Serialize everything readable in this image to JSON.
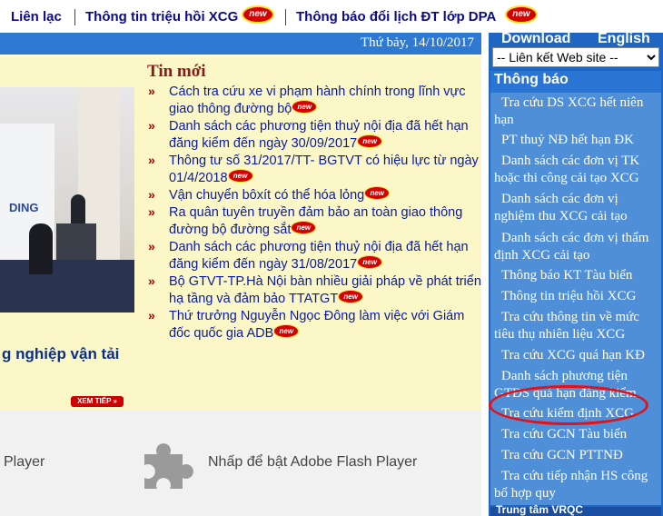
{
  "topnav": {
    "contact": "Liên lạc",
    "recall_info": "Thông tin triệu hồi XCG",
    "schedule_change": "Thông báo đổi lịch ĐT lớp DPA",
    "new_badge": "new"
  },
  "datebar": {
    "date": "Thứ bảy, 14/10/2017"
  },
  "banner": {
    "caption": "g nghiệp vận tải",
    "more_label": "XEM TIẾP »",
    "logo_fragment": "DING"
  },
  "news": {
    "heading": "Tin mới",
    "items": [
      "Cách tra cứu xe vi phạm hành chính trong lĩnh vực giao thông đường bộ",
      "Danh sách các phương tiện thuỷ nội địa đã hết hạn đăng kiểm đến ngày 30/09/2017",
      "Thông tư số 31/2017/TT- BGTVT có hiệu lực từ ngày 01/4/2018",
      "Vận chuyển bôxít có thể hóa lỏng",
      "Ra quân tuyên truyền đảm bảo an toàn giao thông đường bộ đường sắt",
      "Danh sách các phương tiện thuỷ nội địa đã hết hạn đăng kiểm đến ngày 31/08/2017",
      "Bộ GTVT-TP.Hà Nội bàn nhiều giải pháp về phát triển hạ tầng và đảm bảo TTATGT",
      "Thứ trưởng Nguyễn Ngọc Đông làm việc với Giám đốc quốc gia ADB"
    ],
    "new_badge": "new"
  },
  "flash": {
    "left_text": "Player",
    "prompt": "Nhấp để bật Adobe Flash Player"
  },
  "sidebar": {
    "download": "Download",
    "english": "English",
    "select_value": "-- Liên kết Web site --",
    "heading": "Thông báo",
    "links": [
      "Tra cứu DS XCG hết niên hạn",
      "PT thuỷ NĐ hết hạn ĐK",
      "Danh sách các đơn vị TK hoặc thi công cải tạo XCG",
      "Danh sách các đơn vị nghiệm thu XCG cải tạo",
      "Danh sách các đơn vị thẩm định XCG cải tạo",
      "Thông báo KT Tàu biển",
      "Thông tin triệu hồi XCG",
      "Tra cứu thông tin về mức tiêu thụ nhiên liệu XCG",
      "Tra cứu XCG quá hạn KĐ",
      "Danh sách phương tiện GTĐS quá hạn đăng kiểm",
      "Tra cứu kiểm định XCG",
      "Tra cứu GCN Tàu biển",
      "Tra cứu GCN PTTNĐ",
      "Tra cứu tiếp nhận HS công bố hợp quy"
    ],
    "bottom": "Trung tâm VRQC"
  },
  "colors": {
    "nav_text": "#0b0b8a",
    "date_bar": "#2e79d2",
    "news_bg": "#fbf7c6",
    "sidebar": "#4e8fd8",
    "highlight": "#e0121a"
  }
}
